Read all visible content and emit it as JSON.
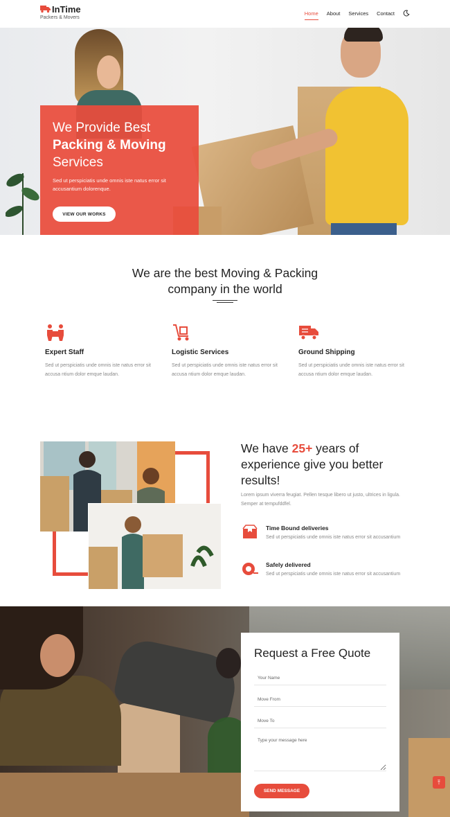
{
  "brand": {
    "name": "InTime",
    "tagline": "Packers & Movers",
    "accent_color": "#e74c3c"
  },
  "nav": {
    "items": [
      {
        "label": "Home",
        "active": true
      },
      {
        "label": "About",
        "active": false
      },
      {
        "label": "Services",
        "active": false
      },
      {
        "label": "Contact",
        "active": false
      }
    ],
    "theme_toggle_icon": "moon-icon"
  },
  "hero": {
    "line1": "We Provide Best",
    "line2": "Packing & Moving",
    "line3": "Services",
    "text": "Sed ut perspiciatis unde omnis iste natus error sit accusantium dolorenque.",
    "button": "VIEW OUR WORKS"
  },
  "about": {
    "title_line1": "We are the best Moving & Packing",
    "title_line2": "company in the world",
    "features": [
      {
        "icon": "staff-icon",
        "title": "Expert Staff",
        "text": "Sed ut perspiciatis unde omnis iste natus error sit accusa ntium dolor emque laudan."
      },
      {
        "icon": "dolly-icon",
        "title": "Logistic Services",
        "text": "Sed ut perspiciatis unde omnis iste natus error sit accusa ntium dolor emque laudan."
      },
      {
        "icon": "truck-icon",
        "title": "Ground Shipping",
        "text": "Sed ut perspiciatis unde omnis iste natus error sit accusa ntium dolor emque laudan."
      }
    ]
  },
  "experience": {
    "title_before": "We have ",
    "title_accent": "25+",
    "title_after": " years of experience give you better results!",
    "description": "Lorem ipsum viverra feugiat. Pellen tesque libero ut justo, ultrices in ligula. Semper at tempufddfel.",
    "items": [
      {
        "icon": "box-icon",
        "title": "Time Bound deliveries",
        "text": "Sed ut perspiciatis unde omnis iste natus error sit accusantium"
      },
      {
        "icon": "tape-icon",
        "title": "Safely delivered",
        "text": "Sed ut perspiciatis unde omnis iste natus error sit accusantium"
      }
    ]
  },
  "quote": {
    "title": "Request a Free Quote",
    "name_placeholder": "Your Name",
    "from_placeholder": "Move From",
    "to_placeholder": "Move To",
    "message_placeholder": "Type your message here",
    "button": "SEND MESSAGE"
  },
  "scroll_top": {
    "icon": "arrow-up-icon",
    "glyph": "⤒"
  }
}
